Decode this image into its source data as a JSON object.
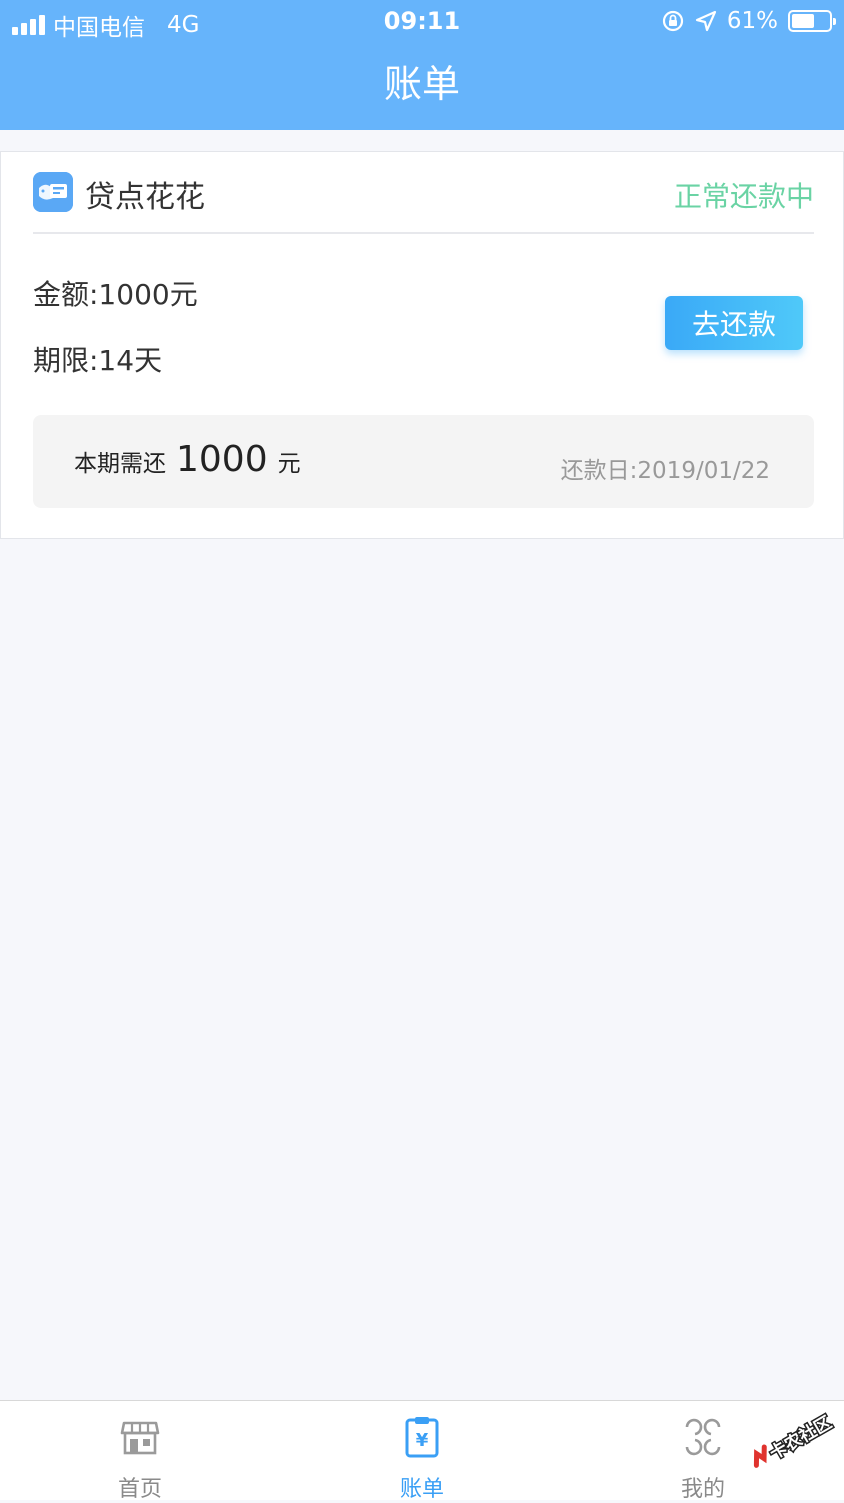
{
  "status_bar": {
    "carrier": "中国电信",
    "network": "4G",
    "time": "09:11",
    "battery": "61%",
    "battery_level": 0.61
  },
  "nav": {
    "title": "账单"
  },
  "loan": {
    "app_name": "贷点花花",
    "status": "正常还款中",
    "amount": "金额:1000元",
    "term": "期限:14天",
    "repay_button": "去还款",
    "due_prefix": "本期需还",
    "due_amount": "1000",
    "due_unit": "元",
    "due_date": "还款日:2019/01/22"
  },
  "tabs": [
    {
      "label": "首页",
      "icon": "store-icon",
      "active": false
    },
    {
      "label": "账单",
      "icon": "bill-icon",
      "active": true
    },
    {
      "label": "我的",
      "icon": "profile-icon",
      "active": false
    }
  ],
  "watermark": {
    "text": "卡农社区",
    "icon": "kanong-logo"
  },
  "colors": {
    "header": "#66b4fb",
    "status_green": "#6ad3a4",
    "button": "#3aa9f7",
    "tab_active": "#3a9ff5",
    "tab_inactive": "#8a8a8a"
  }
}
